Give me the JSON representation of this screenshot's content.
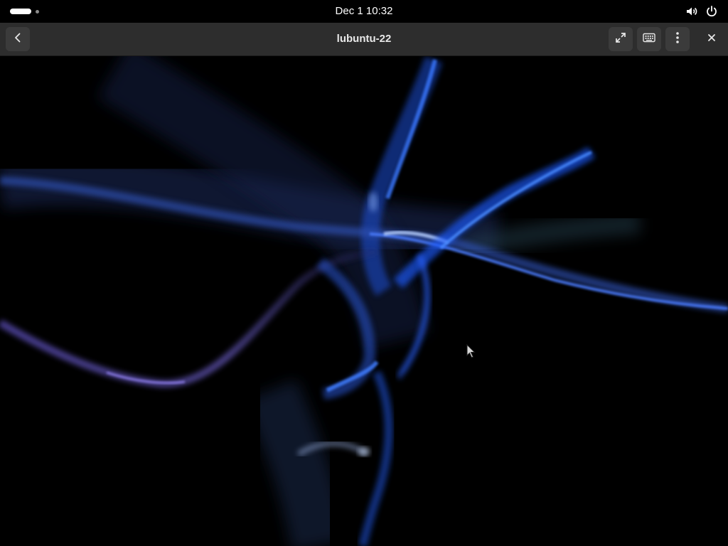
{
  "topbar": {
    "clock": "Dec 1  10:32",
    "volume_icon": "volume-icon",
    "power_icon": "power-icon"
  },
  "headerbar": {
    "title": "lubuntu-22",
    "back_icon": "back-arrow-icon",
    "fullscreen_icon": "fullscreen-icon",
    "keyboard_icon": "keyboard-icon",
    "menu_icon": "kebab-menu-icon",
    "close_icon": "close-icon"
  },
  "remote_display": {
    "wallpaper_icon": "abstract-blue-swirl-wallpaper",
    "accent_color": "#2f6bff"
  }
}
